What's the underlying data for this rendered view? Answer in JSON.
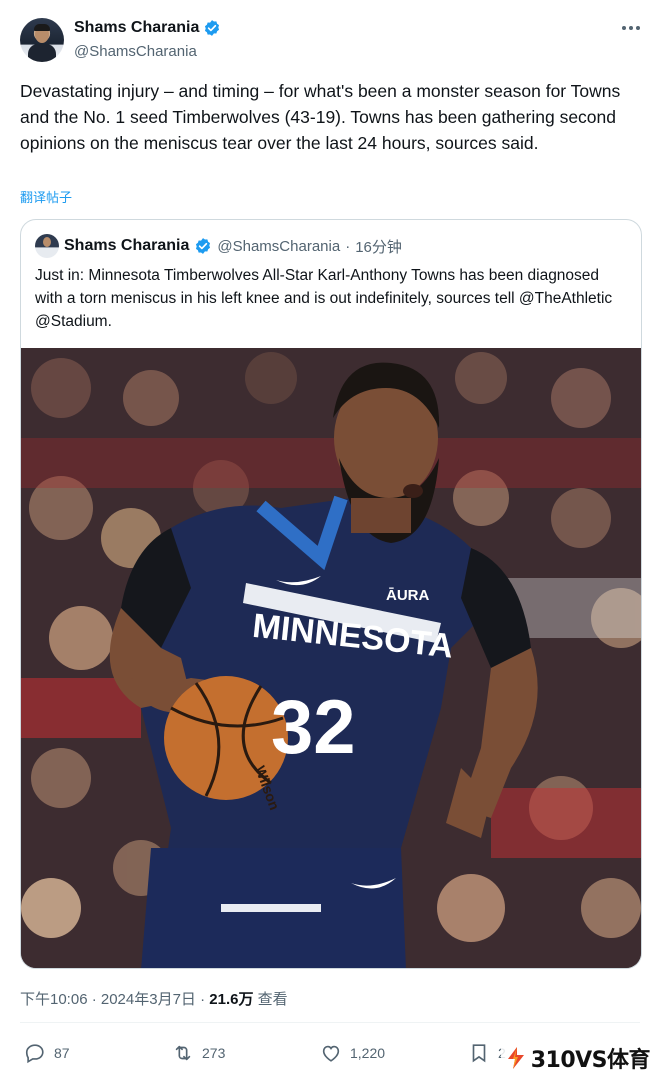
{
  "author": {
    "display_name": "Shams Charania",
    "handle": "@ShamsCharania"
  },
  "tweet": {
    "text": "Devastating injury – and timing – for what's been a monster season for Towns and the No. 1 seed Timberwolves (43-19). Towns has been gathering second opinions on the meniscus tear over the last 24 hours, sources said.",
    "translate_label": "翻译帖子"
  },
  "quoted": {
    "display_name": "Shams Charania",
    "handle": "@ShamsCharania",
    "separator": "·",
    "time": "16分钟",
    "text": "Just in: Minnesota Timberwolves All-Star Karl-Anthony Towns has been diagnosed with a torn meniscus in his left knee and is out indefinitely, sources tell @TheAthletic @Stadium.",
    "photo": {
      "jersey_sponsor": "ĀURA",
      "jersey_team": "MINNESOTA",
      "jersey_number": "32",
      "ball_brand": "Wilson"
    }
  },
  "meta": {
    "timestamp": "下午10:06 · 2024年3月7日 · ",
    "views": "21.6万",
    "views_label": " 查看"
  },
  "actions": {
    "replies": "87",
    "retweets": "273",
    "likes": "1,220",
    "bookmarks": "2"
  },
  "watermark": {
    "text": "310VS体育"
  },
  "colors": {
    "accent": "#1d9bf0",
    "jersey": "#1e2a55",
    "jersey_accent": "#2f6fc6"
  }
}
